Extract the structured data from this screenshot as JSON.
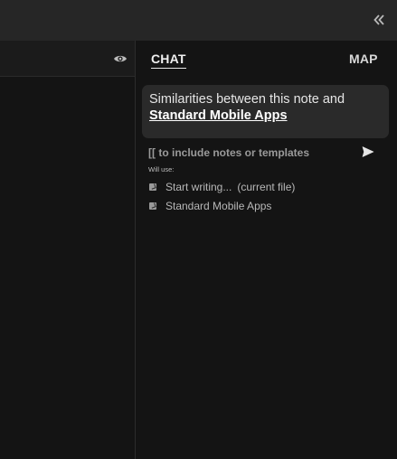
{
  "titlebar": {
    "collapse_icon": "double-chevron-left-icon",
    "collapse_glyph": "«"
  },
  "left_pane": {
    "eye_icon": "eye-icon"
  },
  "tabs": [
    {
      "label": "CHAT",
      "active": true
    },
    {
      "label": "MAP",
      "active": false
    }
  ],
  "prompt": {
    "text": "Similarities between this note and",
    "link": "Standard Mobile Apps"
  },
  "input": {
    "placeholder": "[[ to include notes or templates",
    "value": ""
  },
  "send_icon": "send-icon",
  "context": {
    "heading": "Will use:",
    "items": [
      {
        "label": "Start writing...",
        "note": "(current file)",
        "checked": true
      },
      {
        "label": "Standard Mobile Apps",
        "note": "",
        "checked": true
      }
    ]
  },
  "colors": {
    "background": "#141414",
    "titlebar": "#262626",
    "card": "#2a2a2a",
    "accent_text": "#ffffff"
  }
}
